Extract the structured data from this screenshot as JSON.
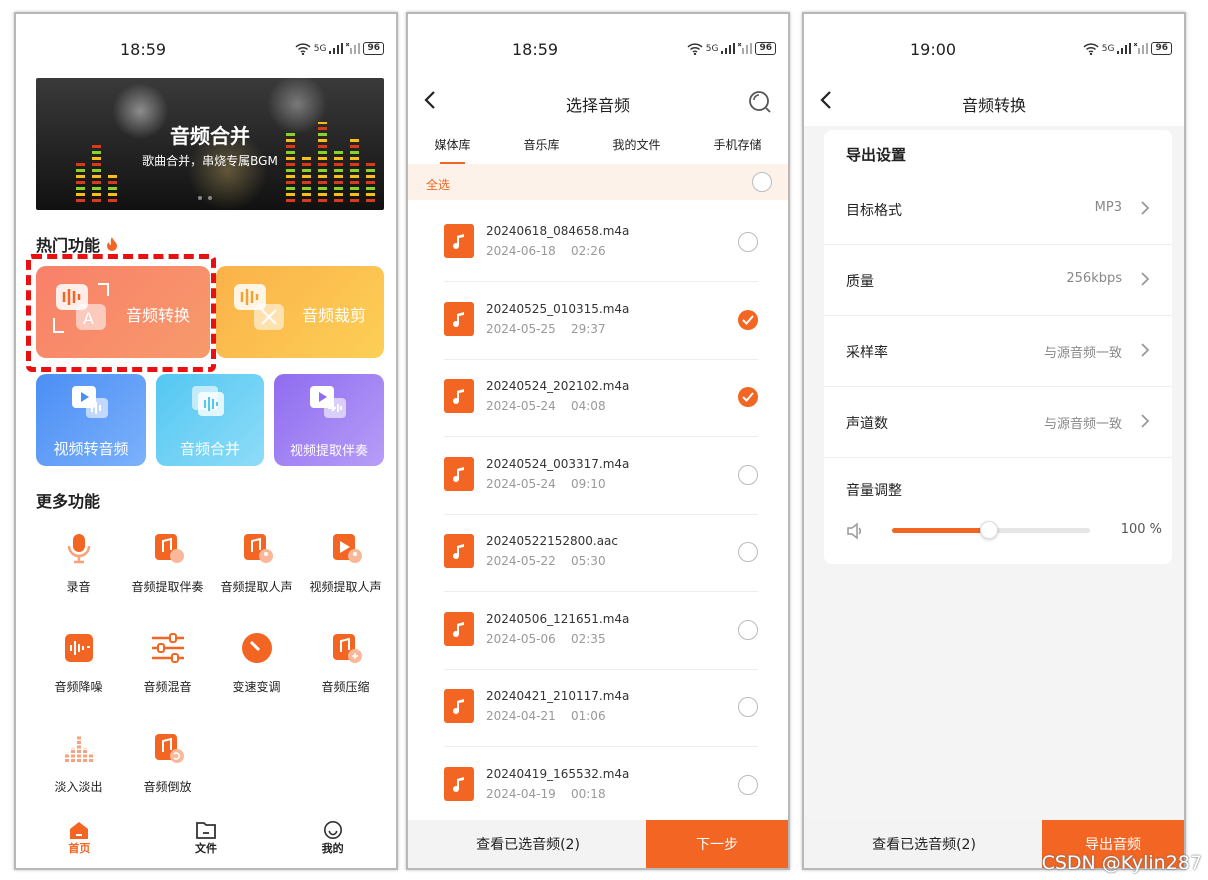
{
  "screen1": {
    "status": {
      "time": "18:59",
      "signal": "5G",
      "battery": "96"
    },
    "banner": {
      "title": "音频合并",
      "subtitle": "歌曲合并，串烧专属BGM"
    },
    "hot_title": "热门功能",
    "hot": [
      {
        "label": "音频转换"
      },
      {
        "label": "音频裁剪"
      },
      {
        "label": "视频转音频"
      },
      {
        "label": "音频合并"
      },
      {
        "label": "视频提取伴奏"
      }
    ],
    "more_title": "更多功能",
    "more": [
      {
        "label": "录音"
      },
      {
        "label": "音频提取伴奏"
      },
      {
        "label": "音频提取人声"
      },
      {
        "label": "视频提取人声"
      },
      {
        "label": "音频降噪"
      },
      {
        "label": "音频混音"
      },
      {
        "label": "变速变调"
      },
      {
        "label": "音频压缩"
      },
      {
        "label": "淡入淡出"
      },
      {
        "label": "音频倒放"
      }
    ],
    "nav": [
      {
        "label": "首页"
      },
      {
        "label": "文件"
      },
      {
        "label": "我的"
      }
    ],
    "colors": {
      "accent": "#f26522",
      "highlight": "#e81010"
    }
  },
  "screen2": {
    "status": {
      "time": "18:59",
      "signal": "5G",
      "battery": "96"
    },
    "title": "选择音频",
    "tabs": [
      {
        "label": "媒体库"
      },
      {
        "label": "音乐库"
      },
      {
        "label": "我的文件"
      },
      {
        "label": "手机存储"
      }
    ],
    "select_all": "全选",
    "files": [
      {
        "name": "20240618_084658.m4a",
        "meta": "2024-06-18    02:26",
        "selected": false
      },
      {
        "name": "20240525_010315.m4a",
        "meta": "2024-05-25    29:37",
        "selected": true
      },
      {
        "name": "20240524_202102.m4a",
        "meta": "2024-05-24    04:08",
        "selected": true
      },
      {
        "name": "20240524_003317.m4a",
        "meta": "2024-05-24    09:10",
        "selected": false
      },
      {
        "name": "20240522152800.aac",
        "meta": "2024-05-22    05:30",
        "selected": false
      },
      {
        "name": "20240506_121651.m4a",
        "meta": "2024-05-06    02:35",
        "selected": false
      },
      {
        "name": "20240421_210117.m4a",
        "meta": "2024-04-21    01:06",
        "selected": false
      },
      {
        "name": "20240419_165532.m4a",
        "meta": "2024-04-19    00:18",
        "selected": false
      }
    ],
    "view_selected": "查看已选音频(2)",
    "next": "下一步"
  },
  "screen3": {
    "status": {
      "time": "19:00",
      "signal": "5G",
      "battery": "96"
    },
    "title": "音频转换",
    "section": "导出设置",
    "rows": [
      {
        "key": "目标格式",
        "value": "MP3"
      },
      {
        "key": "质量",
        "value": "256kbps"
      },
      {
        "key": "采样率",
        "value": "与源音频一致"
      },
      {
        "key": "声道数",
        "value": "与源音频一致"
      }
    ],
    "volume_label": "音量调整",
    "volume_value": "100 %",
    "volume_level": 0.49,
    "view_selected": "查看已选音频(2)",
    "export": "导出音频"
  },
  "watermark": "CSDN @Kylin287"
}
